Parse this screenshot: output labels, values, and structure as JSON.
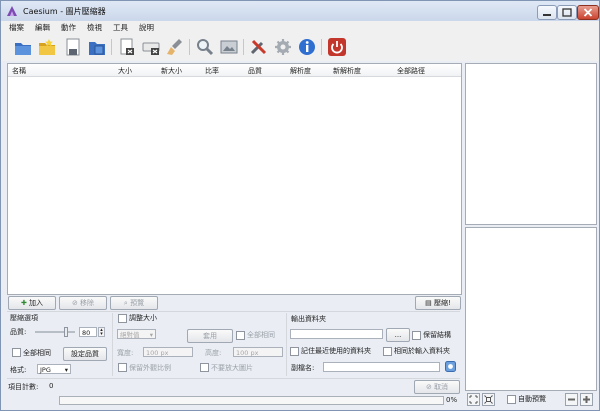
{
  "window": {
    "title": "Caesium - 圖片壓縮器"
  },
  "menu": [
    "檔案",
    "編輯",
    "動作",
    "檢視",
    "工具",
    "說明"
  ],
  "toolbar": {
    "icons": [
      "open-file-icon",
      "open-folder-icon",
      "save-icon",
      "save-all-icon",
      "remove-item-icon",
      "clear-list-icon",
      "brush-icon",
      "zoom-icon",
      "preview-image-icon",
      "tools-icon",
      "settings-icon",
      "info-icon",
      "power-icon"
    ],
    "accent": "#c3362b"
  },
  "columns": [
    "名稱",
    "大小",
    "新大小",
    "比率",
    "品質",
    "解析度",
    "新解析度",
    "全部路徑"
  ],
  "list_buttons": {
    "add": "加入",
    "remove": "移除",
    "preview": "預覽",
    "compress": "壓縮!"
  },
  "compression": {
    "section_title": "壓縮選項",
    "quality_label": "品質:",
    "quality_value": "80",
    "quality_percent": 80,
    "same_for_all": "全部相同",
    "set_quality": "設定品質",
    "format_label": "格式:",
    "format_value": "JPG"
  },
  "resize": {
    "section_title": "調整大小",
    "mode_value": "絕對值",
    "apply": "套用",
    "all_same": "全部相同",
    "width_label": "寬度:",
    "width_value": "100 px",
    "height_label": "高度:",
    "height_value": "100 px",
    "keep_ratio": "保留外觀比例",
    "no_enlarge": "不要放大圖片"
  },
  "output": {
    "section_title": "輸出資料夾",
    "browse": "...",
    "keep_structure": "保留結構",
    "remember_folder": "記住最近使用的資料夾",
    "same_as_input": "相同於輸入資料夾",
    "suffix_label": "副檔名:",
    "suffix_value": ""
  },
  "status": {
    "item_count_label": "項目計數:",
    "item_count_value": "0",
    "cancel": "取消",
    "progress_text": "0%",
    "progress": 0,
    "auto_preview": "自動預覽"
  }
}
